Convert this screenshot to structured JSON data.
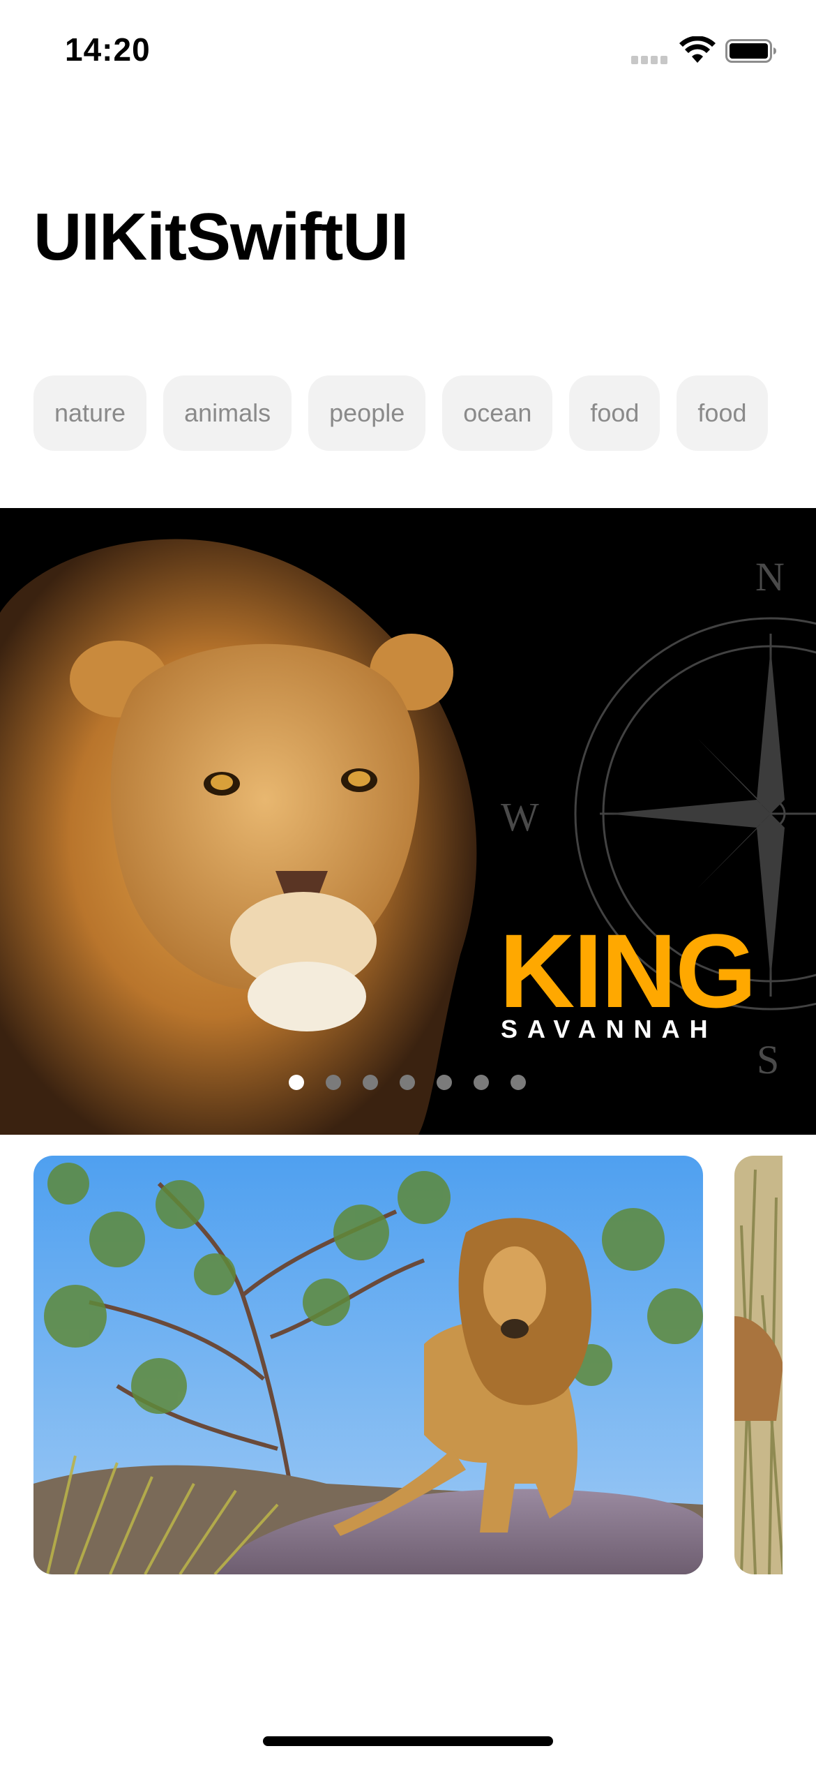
{
  "status_bar": {
    "time": "14:20"
  },
  "header": {
    "title": "UIKitSwiftUI"
  },
  "categories": [
    "nature",
    "animals",
    "people",
    "ocean",
    "food",
    "food"
  ],
  "hero": {
    "title": "KING",
    "subtitle": "SAVANNAH",
    "compass": {
      "n": "N",
      "w": "W",
      "s": "S"
    },
    "page_count": 7,
    "current_page": 1,
    "title_color": "#FFA800"
  },
  "cards": [
    {
      "image": "lion-standing-on-rock"
    },
    {
      "image": "lion-in-grass-partial"
    }
  ]
}
